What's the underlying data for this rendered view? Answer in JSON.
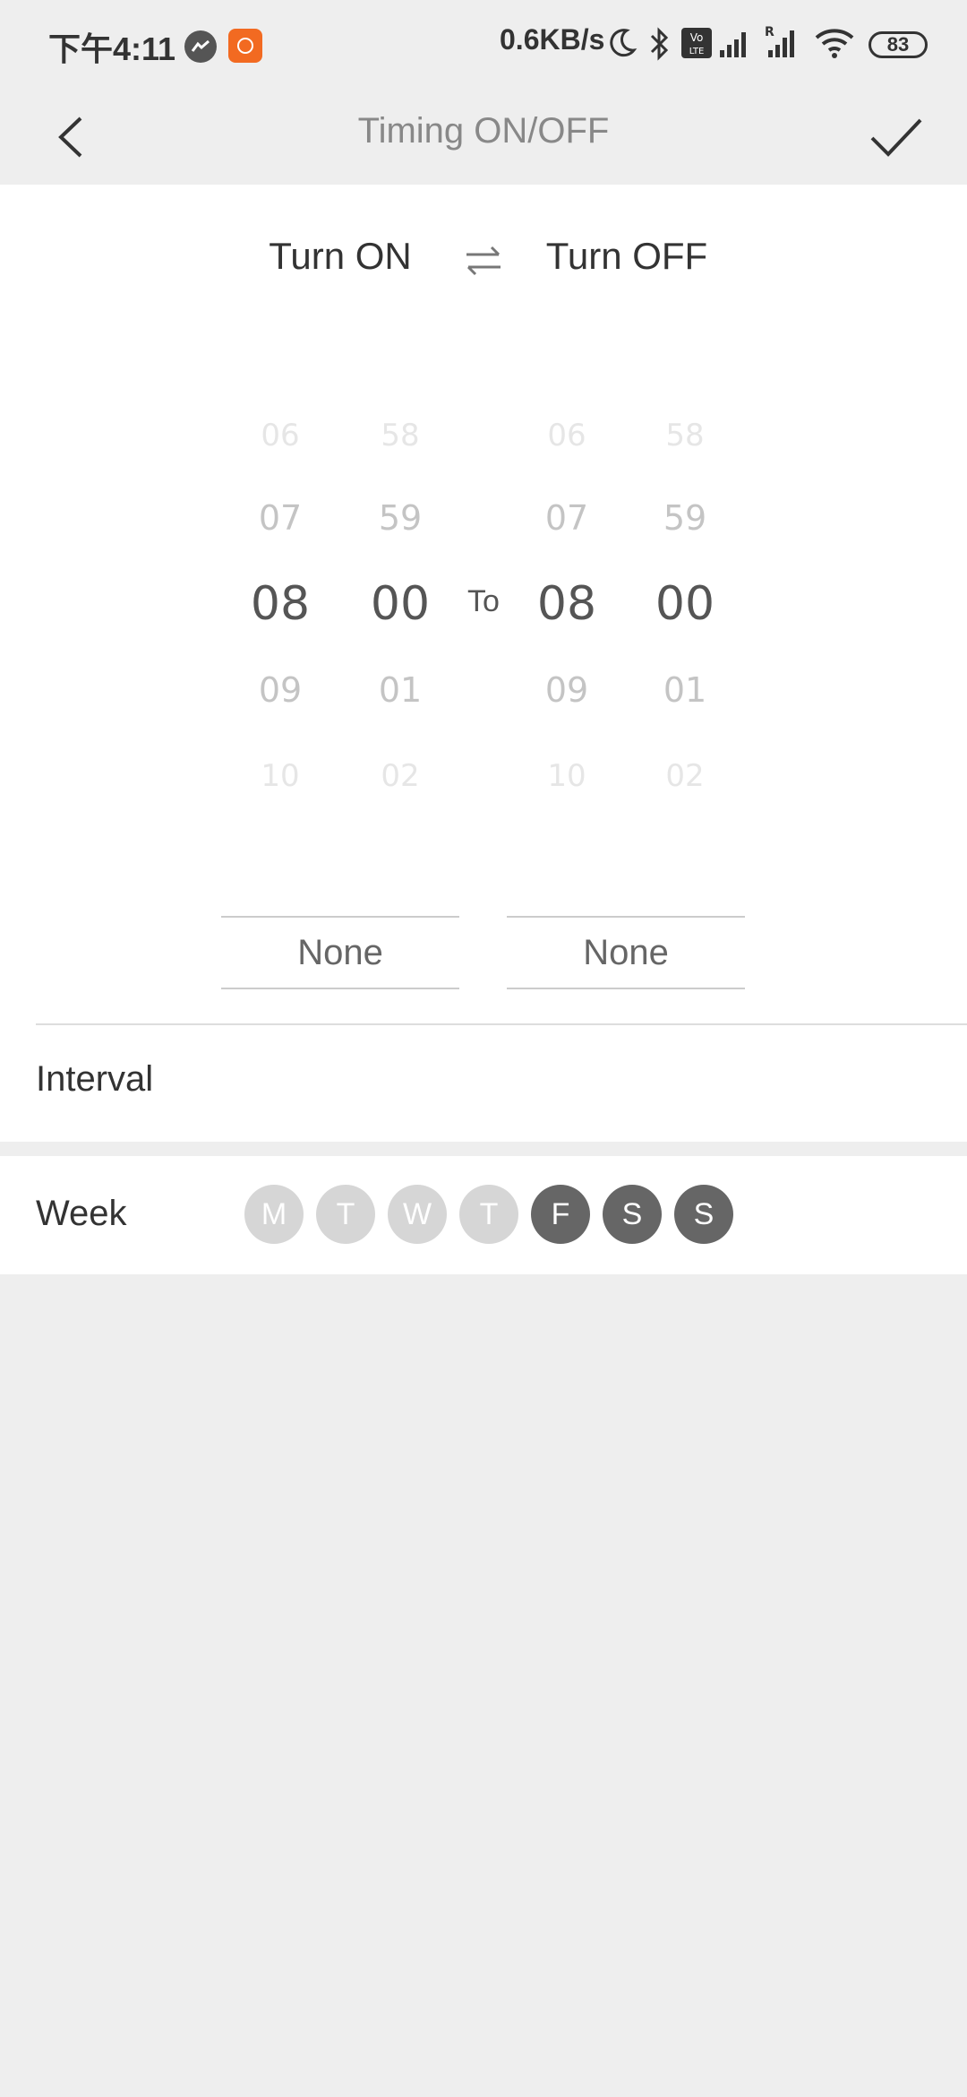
{
  "status_bar": {
    "time": "下午4:11",
    "speed": "0.6KB/s",
    "battery": "83",
    "icons": [
      "messenger-icon",
      "app-notification-icon",
      "moon-icon",
      "bluetooth-icon",
      "volte-icon",
      "signal-icon",
      "roaming-signal-icon",
      "wifi-icon",
      "battery-icon"
    ]
  },
  "header": {
    "title": "Timing ON/OFF",
    "back_icon": "chevron-left-icon",
    "confirm_icon": "checkmark-icon"
  },
  "mode": {
    "on_label": "Turn ON",
    "off_label": "Turn OFF",
    "swap_icon": "swap-arrows-icon"
  },
  "picker": {
    "on_hours": [
      "06",
      "07",
      "08",
      "09",
      "10"
    ],
    "on_minutes": [
      "58",
      "59",
      "00",
      "01",
      "02"
    ],
    "off_hours": [
      "06",
      "07",
      "08",
      "09",
      "10"
    ],
    "off_minutes": [
      "58",
      "59",
      "00",
      "01",
      "02"
    ],
    "to_label": "To"
  },
  "actions": {
    "on_action": "None",
    "off_action": "None"
  },
  "interval": {
    "label": "Interval"
  },
  "week": {
    "label": "Week",
    "days": [
      {
        "label": "M",
        "selected": false
      },
      {
        "label": "T",
        "selected": false
      },
      {
        "label": "W",
        "selected": false
      },
      {
        "label": "T",
        "selected": false
      },
      {
        "label": "F",
        "selected": true
      },
      {
        "label": "S",
        "selected": true
      },
      {
        "label": "S",
        "selected": true
      }
    ]
  },
  "colors": {
    "day_selected": "#666666",
    "day_unselected": "#d6d6d6",
    "background": "#eeeeee"
  }
}
